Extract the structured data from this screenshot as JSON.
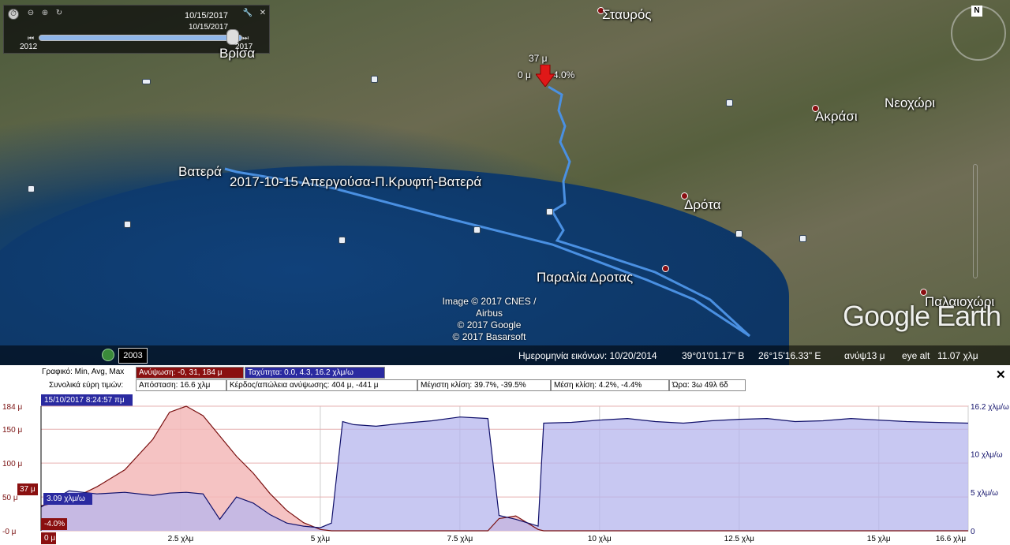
{
  "map": {
    "time_slider": {
      "date_top": "10/15/2017",
      "date_current": "10/15/2017",
      "start_year": "2012",
      "end_year": "2017"
    },
    "labels": {
      "stavros": "Σταυρός",
      "vrisa": "Βρίσα",
      "neochori": "Νεοχώρι",
      "akrasi": "Ακράσι",
      "vatera": "Βατερά",
      "track_name": "2017-10-15 Απεργούσα-Π.Κρυφτή-Βατερά",
      "drota": "Δρότα",
      "paralia_drotas": "Παραλία Δροτας",
      "palaiochori": "Παλαιοχώρι"
    },
    "marker": {
      "elevation": "37 μ",
      "distance": "0 μ",
      "slope": "-4.0%"
    },
    "credits": [
      "Image © 2017 CNES / Airbus",
      "© 2017 Google",
      "© 2017 Basarsoft"
    ],
    "logo": "Google Earth",
    "historical_year": "2003",
    "status": {
      "imagery_date": "Ημερομηνία εικόνων: 10/20/2014",
      "lat": "39°01'01.17\" B",
      "lon": "26°15'16.33\" E",
      "elev_label": "ανύψ",
      "elev_value": "13 μ",
      "eye_alt_label": "eye alt",
      "eye_alt_value": "11.07 χλμ"
    },
    "compass_north": "N"
  },
  "profile": {
    "row1_label": "Γραφικό: Min, Avg, Max",
    "elevation_box": "Ανύψωση: -0, 31, 184 μ",
    "speed_box": "Ταχύτητα: 0.0, 4.3, 16.2 χλμ/ω",
    "row2_label": "Συνολικά εύρη τιμών:",
    "distance_box": "Απόσταση: 16.6 χλμ",
    "gainloss_box": "Κέρδος/απώλεια ανύψωσης: 404 μ, -441 μ",
    "max_slope_box": "Μέγιστη κλίση: 39.7%, -39.5%",
    "avg_slope_box": "Μέση κλίση: 4.2%, -4.4%",
    "time_box": "Ώρα: 3ω 49λ 6δ",
    "timestamp": "15/10/2017 8:24:57 πμ",
    "close": "✕",
    "cursor_elev": "37 μ",
    "cursor_speed": "3.09 χλμ/ω",
    "cursor_slope": "-4.0%",
    "cursor_dist": "0 μ",
    "colors": {
      "elevation": "#7a1010",
      "elevation_fill": "#f3b8b8",
      "speed": "#10106a",
      "speed_fill": "#b6b6ee"
    }
  },
  "chart_data": {
    "type": "area",
    "xlabel": "",
    "ylabel": "",
    "x_ticks": [
      "2.5 χλμ",
      "5 χλμ",
      "7.5 χλμ",
      "10 χλμ",
      "12.5 χλμ",
      "15 χλμ",
      "16.6 χλμ"
    ],
    "y_left_ticks": [
      "184 μ",
      "150 μ",
      "100 μ",
      "50 μ",
      "-0 μ"
    ],
    "y_right_ticks": [
      "16.2 χλμ/ω",
      "10 χλμ/ω",
      "5 χλμ/ω",
      "0"
    ],
    "xlim": [
      0,
      16.6
    ],
    "ylim_left": [
      0,
      184
    ],
    "ylim_right": [
      0,
      16.2
    ],
    "x": [
      0,
      0.5,
      1,
      1.5,
      2,
      2.3,
      2.6,
      2.9,
      3.2,
      3.5,
      3.8,
      4.1,
      4.4,
      4.7,
      5.0,
      5.2,
      5.4,
      5.6,
      6.0,
      6.5,
      7.0,
      7.5,
      8.0,
      8.2,
      8.5,
      8.9,
      9.0,
      9.5,
      10,
      10.5,
      11,
      11.5,
      12,
      12.5,
      13,
      13.5,
      14,
      14.5,
      15,
      15.5,
      16,
      16.6
    ],
    "series": [
      {
        "values": [
          37,
          45,
          65,
          90,
          135,
          175,
          184,
          170,
          140,
          110,
          85,
          55,
          30,
          12,
          2,
          0,
          0,
          0,
          0,
          0,
          0,
          0,
          0,
          18,
          22,
          2,
          0,
          0,
          0,
          0,
          0,
          0,
          0,
          0,
          0,
          0,
          0,
          0,
          0,
          0,
          0,
          0
        ]
      },
      {
        "values": [
          3.1,
          5.2,
          4.8,
          5.0,
          4.6,
          4.9,
          5.0,
          4.8,
          1.5,
          4.4,
          3.6,
          2.1,
          1.0,
          0.6,
          0.4,
          1.0,
          14.2,
          13.8,
          13.6,
          14.0,
          14.3,
          14.8,
          14.6,
          2.0,
          1.5,
          0.6,
          14.0,
          14.1,
          14.4,
          14.6,
          14.2,
          14.0,
          14.3,
          14.5,
          14.6,
          14.2,
          14.3,
          14.6,
          14.4,
          14.2,
          14.1,
          14.0
        ]
      }
    ]
  }
}
